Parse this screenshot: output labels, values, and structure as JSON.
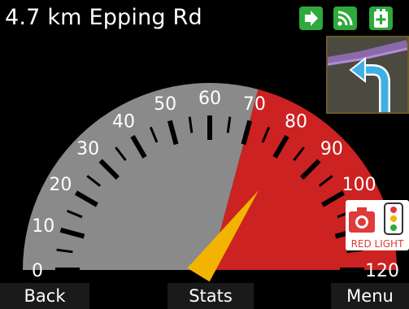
{
  "status": {
    "distance_text": "4.7 km Epping Rd",
    "icons": [
      "arrow-right-icon",
      "signal-icon",
      "battery-icon"
    ],
    "icon_color": "#2fa83c"
  },
  "speedometer": {
    "min": 0,
    "max": 120,
    "tick_labels": [
      "0",
      "10",
      "20",
      "30",
      "40",
      "50",
      "60",
      "70",
      "80",
      "90",
      "100",
      "120"
    ],
    "speed_limit": 70,
    "current_speed": 81,
    "colors": {
      "under_limit": "#8a8a8a",
      "over_limit": "#cc2222",
      "needle": "#f2b400"
    }
  },
  "alert": {
    "label": "RED LIGHT",
    "icons": [
      "camera-icon",
      "traffic-light-icon"
    ]
  },
  "mini_map": {
    "icon": "turn-left-arrow-icon"
  },
  "softkeys": {
    "back": "Back",
    "stats": "Stats",
    "menu": "Menu"
  }
}
